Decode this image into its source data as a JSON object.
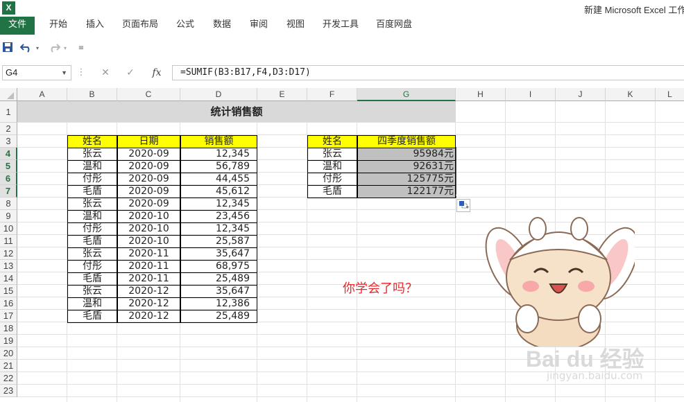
{
  "app": {
    "logo_letter": "X",
    "title": "新建 Microsoft Excel 工作"
  },
  "ribbon": {
    "tabs": [
      {
        "label": "文件",
        "active": true
      },
      {
        "label": "开始"
      },
      {
        "label": "插入"
      },
      {
        "label": "页面布局"
      },
      {
        "label": "公式"
      },
      {
        "label": "数据"
      },
      {
        "label": "审阅"
      },
      {
        "label": "视图"
      },
      {
        "label": "开发工具"
      },
      {
        "label": "百度网盘"
      }
    ],
    "accent": "#217346"
  },
  "quick_access": {
    "save_icon": "save-icon",
    "undo_icon": "undo-icon",
    "redo_icon": "redo-icon",
    "customize_icon": "customize-icon"
  },
  "formula_bar": {
    "name_box": "G4",
    "cancel_glyph": "✕",
    "enter_glyph": "✓",
    "fx_label": "fx",
    "formula": "=SUMIF(B3:B17,F4,D3:D17)"
  },
  "columns": [
    "A",
    "B",
    "C",
    "D",
    "E",
    "F",
    "G",
    "H",
    "I",
    "J",
    "K",
    "L"
  ],
  "selected_column": "G",
  "rows": [
    "1",
    "2",
    "3",
    "4",
    "5",
    "6",
    "7",
    "8",
    "9",
    "10",
    "11",
    "12",
    "13",
    "14",
    "15",
    "16",
    "17",
    "18",
    "19",
    "20",
    "21",
    "22",
    "23"
  ],
  "selected_rows": [
    "4",
    "5",
    "6",
    "7"
  ],
  "sheet": {
    "title": "统计销售额",
    "main_table": {
      "headers": [
        "姓名",
        "日期",
        "销售额"
      ],
      "rows": [
        [
          "张云",
          "2020-09",
          "12,345"
        ],
        [
          "温和",
          "2020-09",
          "56,789"
        ],
        [
          "付彤",
          "2020-09",
          "44,455"
        ],
        [
          "毛盾",
          "2020-09",
          "45,612"
        ],
        [
          "张云",
          "2020-09",
          "12,345"
        ],
        [
          "温和",
          "2020-10",
          "23,456"
        ],
        [
          "付彤",
          "2020-10",
          "12,345"
        ],
        [
          "毛盾",
          "2020-10",
          "25,587"
        ],
        [
          "张云",
          "2020-11",
          "35,647"
        ],
        [
          "付彤",
          "2020-11",
          "68,975"
        ],
        [
          "毛盾",
          "2020-11",
          "25,489"
        ],
        [
          "张云",
          "2020-12",
          "35,647"
        ],
        [
          "温和",
          "2020-12",
          "12,386"
        ],
        [
          "毛盾",
          "2020-12",
          "25,489"
        ]
      ]
    },
    "summary_table": {
      "headers": [
        "姓名",
        "四季度销售额"
      ],
      "rows": [
        [
          "张云",
          "95984元"
        ],
        [
          "温和",
          "92631元"
        ],
        [
          "付彤",
          "125775元"
        ],
        [
          "毛盾",
          "122177元"
        ]
      ]
    },
    "question": "你学会了吗？",
    "paste_options_icon": "paste-options-icon"
  },
  "colors": {
    "header_fill": "#ffff00",
    "selection_fill": "#c0c0c0",
    "title_fill": "#d9d9d9",
    "question_text": "#e8272b"
  },
  "watermark": {
    "brand": "Bai du 经验",
    "url": "jingyan.baidu.com"
  }
}
